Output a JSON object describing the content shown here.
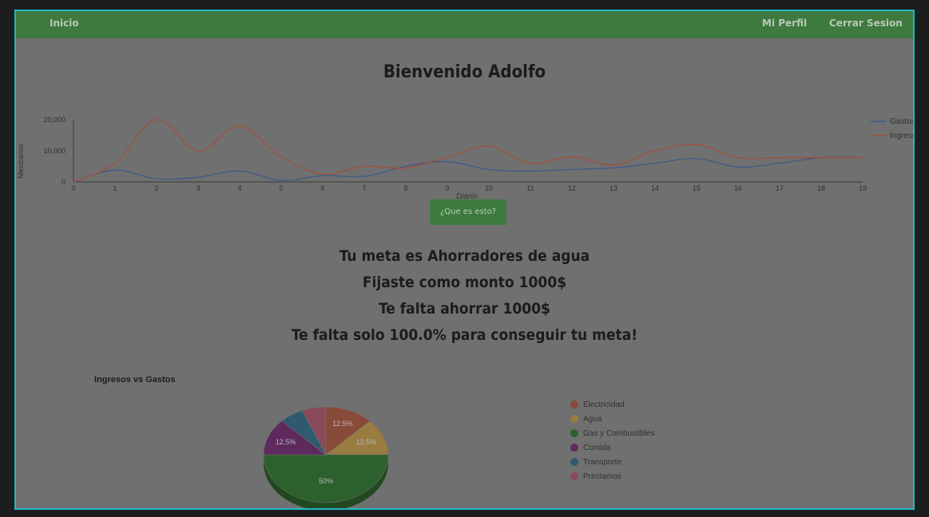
{
  "nav": {
    "home": "Inicio",
    "profile": "Mi Perfil",
    "logout": "Cerrar Sesion"
  },
  "welcome": "Bienvenido Adolfo",
  "whatIs_button": "¿Que es esto?",
  "goal": {
    "line1": "Tu meta es Ahorradores de agua",
    "line2": "Fijaste como monto 1000$",
    "line3": "Te falta ahorrar 1000$",
    "line4": "Te falta solo 100.0% para conseguir tu meta!"
  },
  "chart_data": [
    {
      "type": "line",
      "title": "",
      "xlabel": "Diario",
      "ylabel": "Mexicanos",
      "x": [
        0,
        1,
        2,
        3,
        4,
        5,
        6,
        7,
        8,
        9,
        10,
        11,
        12,
        13,
        14,
        15,
        16,
        17,
        18,
        19
      ],
      "ylim": [
        0,
        20000
      ],
      "yticks": [
        "0",
        "10,000",
        "20,000"
      ],
      "legend_position": "right",
      "series": [
        {
          "name": "Gastos",
          "color": "#3d5a88",
          "values": [
            0,
            3800,
            1000,
            1500,
            3500,
            500,
            2000,
            1800,
            5000,
            6500,
            4000,
            3500,
            4000,
            4500,
            6000,
            7500,
            4800,
            6000,
            7800,
            7800
          ]
        },
        {
          "name": "Ingresos",
          "color": "#a0503a",
          "values": [
            0,
            6000,
            20000,
            10000,
            18000,
            8000,
            2500,
            5000,
            4500,
            8000,
            11500,
            6000,
            8000,
            5500,
            10000,
            12000,
            7800,
            7800,
            7800,
            7800
          ]
        }
      ]
    },
    {
      "type": "pie",
      "title": "Ingresos vs Gastos",
      "legend_position": "right",
      "categories": [
        "Electricidad",
        "Agua",
        "Gas y Combustibles",
        "Comida",
        "Transporte",
        "Prestamos"
      ],
      "values": [
        12.5,
        12.5,
        50,
        12.5,
        6.25,
        6.25
      ],
      "labels": [
        "12.5%",
        "12.5%",
        "50%",
        "12.5%",
        "",
        ""
      ],
      "colors": [
        "#8a4a3a",
        "#9a7c40",
        "#2c602c",
        "#5e2a5e",
        "#2e5a6e",
        "#8a4a5a"
      ]
    }
  ]
}
